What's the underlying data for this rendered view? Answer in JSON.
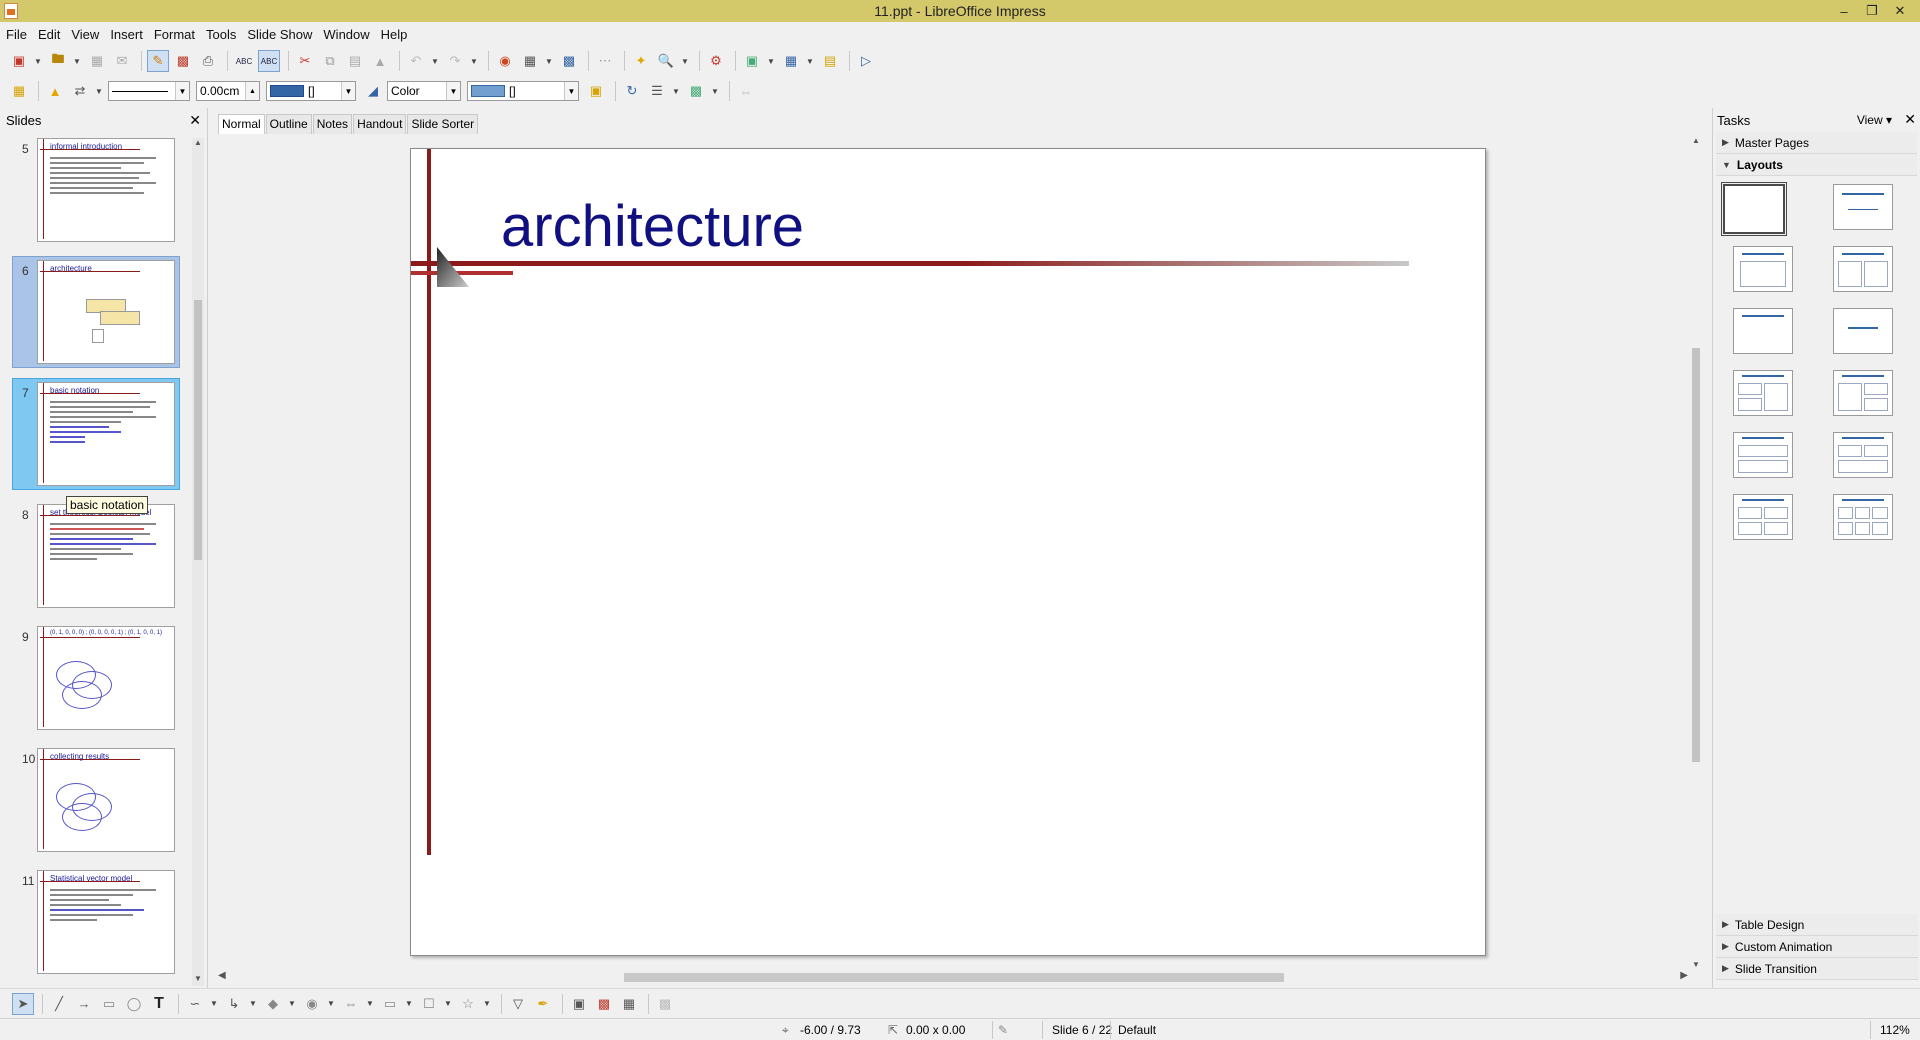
{
  "window": {
    "title": "11.ppt - LibreOffice Impress"
  },
  "menu": [
    "File",
    "Edit",
    "View",
    "Insert",
    "Format",
    "Tools",
    "Slide Show",
    "Window",
    "Help"
  ],
  "toolbar2": {
    "line_width": "0.00cm",
    "line_color_value": "[]",
    "area_style": "Color",
    "area_color_value": "[]"
  },
  "slides_panel": {
    "title": "Slides",
    "tooltip": "basic notation",
    "thumbnails": [
      {
        "num": "5",
        "title": "informal introduction"
      },
      {
        "num": "6",
        "title": "architecture"
      },
      {
        "num": "7",
        "title": "basic notation"
      },
      {
        "num": "8",
        "title": "set theoretic, Boolean model"
      },
      {
        "num": "9",
        "title": "(0, 1, 0, 0, 0) ; (0, 0, 0, 0, 1) ; (0, 1, 0, 0, 1)"
      },
      {
        "num": "10",
        "title": "collecting results"
      },
      {
        "num": "11",
        "title": "Statistical vector model"
      }
    ]
  },
  "view_tabs": [
    "Normal",
    "Outline",
    "Notes",
    "Handout",
    "Slide Sorter"
  ],
  "slide": {
    "title": "architecture"
  },
  "tasks_panel": {
    "title": "Tasks",
    "view_label": "View",
    "sections": {
      "master_pages": "Master Pages",
      "layouts": "Layouts",
      "table_design": "Table Design",
      "custom_animation": "Custom Animation",
      "slide_transition": "Slide Transition"
    }
  },
  "status": {
    "position": "-6.00 / 9.73",
    "size": "0.00 x 0.00",
    "slide": "Slide 6 / 22",
    "master": "Default",
    "zoom": "112%"
  },
  "colors": {
    "titlebar": "#d4c96a",
    "slide_title": "#101080",
    "accent_line": "#8b1a1a",
    "selection": "#a9c4e6"
  }
}
